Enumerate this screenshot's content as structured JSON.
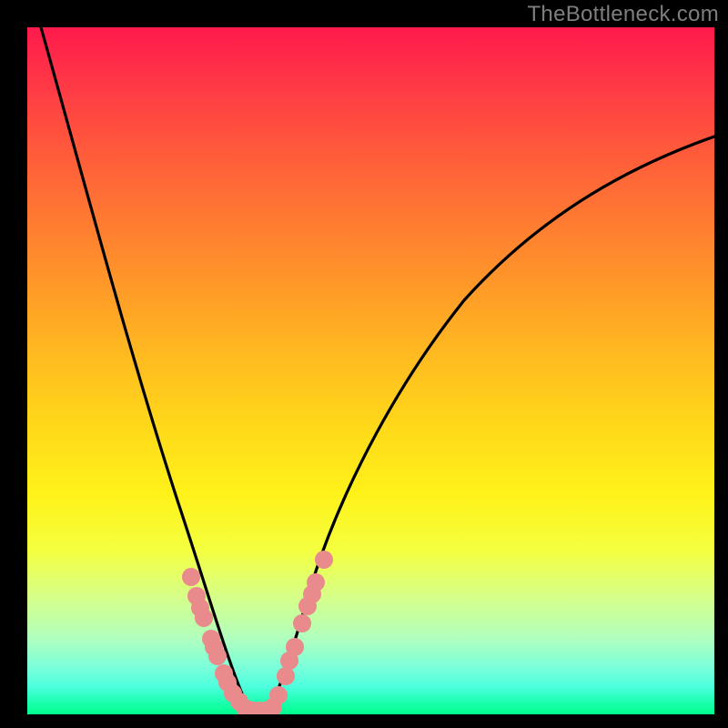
{
  "watermark": "TheBottleneck.com",
  "colors": {
    "watermark_text": "#7e7e7e",
    "background_black": "#000000",
    "curve_stroke": "#000000",
    "marker_fill": "#e98a8d",
    "gradient_top": "#ff1a4c",
    "gradient_bottom": "#00ff8c"
  },
  "chart_data": {
    "type": "line",
    "title": "",
    "xlabel": "",
    "ylabel": "",
    "xlim": [
      0,
      100
    ],
    "ylim": [
      0,
      100
    ],
    "axes_visible": false,
    "series": [
      {
        "name": "left-curve",
        "x": [
          2,
          6,
          10,
          14,
          18,
          22,
          24,
          26,
          28,
          29.5,
          31,
          32.5
        ],
        "y": [
          100,
          84,
          68,
          53,
          39,
          25,
          19,
          13,
          8,
          4.5,
          2,
          0.5
        ]
      },
      {
        "name": "right-curve",
        "x": [
          35,
          37,
          39,
          42,
          46,
          52,
          60,
          70,
          82,
          94,
          100
        ],
        "y": [
          0.5,
          4,
          10,
          19,
          30,
          42,
          54,
          65,
          74,
          81,
          84
        ]
      },
      {
        "name": "valley-floor",
        "x": [
          32.5,
          35
        ],
        "y": [
          0.5,
          0.5
        ]
      }
    ],
    "markers": [
      {
        "group": "left-cluster",
        "points": [
          {
            "x": 23.8,
            "y": 20.0
          },
          {
            "x": 24.6,
            "y": 17.2
          },
          {
            "x": 25.2,
            "y": 15.5
          },
          {
            "x": 25.7,
            "y": 14.0
          },
          {
            "x": 26.8,
            "y": 11.0
          },
          {
            "x": 27.2,
            "y": 9.8
          },
          {
            "x": 27.7,
            "y": 8.5
          },
          {
            "x": 28.6,
            "y": 6.0
          },
          {
            "x": 29.2,
            "y": 4.6
          },
          {
            "x": 30.0,
            "y": 3.0
          },
          {
            "x": 30.8,
            "y": 1.8
          },
          {
            "x": 31.8,
            "y": 0.8
          }
        ]
      },
      {
        "group": "right-cluster",
        "points": [
          {
            "x": 35.8,
            "y": 1.0
          },
          {
            "x": 36.6,
            "y": 2.8
          },
          {
            "x": 37.6,
            "y": 5.5
          },
          {
            "x": 38.2,
            "y": 7.8
          },
          {
            "x": 38.9,
            "y": 9.8
          },
          {
            "x": 40.0,
            "y": 13.2
          },
          {
            "x": 40.8,
            "y": 15.8
          },
          {
            "x": 41.4,
            "y": 17.5
          },
          {
            "x": 42.0,
            "y": 19.2
          },
          {
            "x": 43.2,
            "y": 22.5
          }
        ]
      },
      {
        "group": "valley-floor-markers",
        "points": [
          {
            "x": 32.3,
            "y": 0.6
          },
          {
            "x": 33.0,
            "y": 0.5
          },
          {
            "x": 33.8,
            "y": 0.5
          },
          {
            "x": 34.6,
            "y": 0.5
          },
          {
            "x": 35.3,
            "y": 0.6
          }
        ]
      }
    ],
    "background_gradient": {
      "orientation": "vertical",
      "stops": [
        {
          "pos": 0.0,
          "color": "#ff1a4c"
        },
        {
          "pos": 0.5,
          "color": "#ffd81a"
        },
        {
          "pos": 0.8,
          "color": "#f4ff3e"
        },
        {
          "pos": 1.0,
          "color": "#00ff8c"
        }
      ]
    }
  }
}
